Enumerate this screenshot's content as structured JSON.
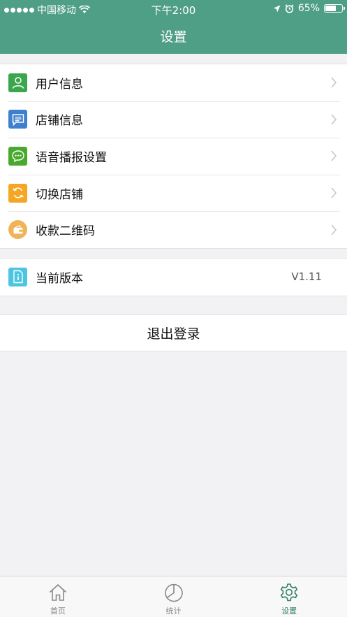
{
  "status_bar": {
    "carrier": "中国移动",
    "time": "下午2:00",
    "battery_percent": "65%",
    "battery_level": 0.65
  },
  "header": {
    "title": "设置"
  },
  "settings_group": [
    {
      "label": "用户信息",
      "icon": "user-icon",
      "color": "#3aa64d"
    },
    {
      "label": "店铺信息",
      "icon": "message-icon",
      "color": "#3f7fd0"
    },
    {
      "label": "语音播报设置",
      "icon": "chat-bubble-icon",
      "color": "#49a92d"
    },
    {
      "label": "切换店铺",
      "icon": "refresh-icon",
      "color": "#f5a623"
    },
    {
      "label": "收款二维码",
      "icon": "wallet-icon",
      "color": "#f0b35a"
    }
  ],
  "version": {
    "label": "当前版本",
    "value": "V1.11",
    "icon": "info-icon",
    "color": "#4ec5e0"
  },
  "logout": {
    "label": "退出登录"
  },
  "tabbar": {
    "tabs": [
      {
        "label": "首页",
        "icon": "home-icon",
        "active": false
      },
      {
        "label": "统计",
        "icon": "pie-chart-icon",
        "active": false
      },
      {
        "label": "设置",
        "icon": "gear-icon",
        "active": true
      }
    ]
  },
  "colors": {
    "accent": "#4f9e86",
    "active_tab": "#2f7d69"
  }
}
